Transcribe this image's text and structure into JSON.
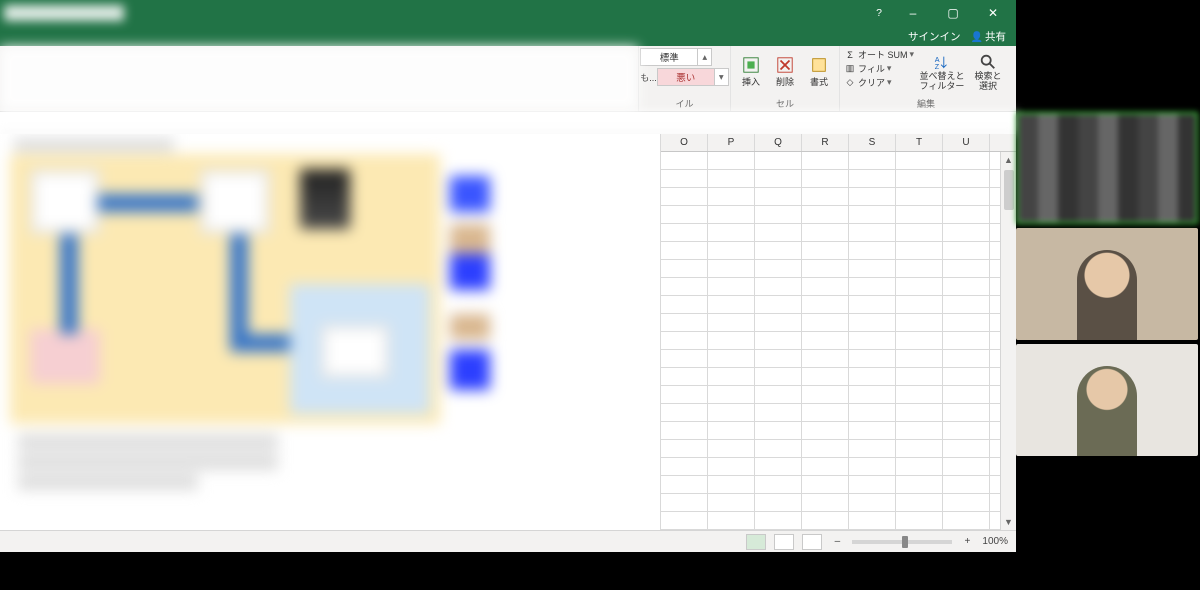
{
  "window": {
    "help_icon": "?",
    "minimize": "–",
    "maximize": "▢",
    "close": "✕"
  },
  "auth": {
    "signin": "サインイン",
    "share": "共有"
  },
  "ribbon": {
    "styles_normal": "標準",
    "styles_bad": "悪い",
    "styles_neutral_prefix": "も...",
    "group_style": "イル",
    "insert": "挿入",
    "delete": "削除",
    "format": "書式",
    "group_cells": "セル",
    "autosum": "オート SUM",
    "fill": "フィル",
    "clear": "クリア",
    "sort_filter": "並べ替えと\nフィルター",
    "find_select": "検索と\n選択",
    "group_edit": "編集"
  },
  "columns": [
    "O",
    "P",
    "Q",
    "R",
    "S",
    "T",
    "U"
  ],
  "status": {
    "zoom_label": "100%"
  }
}
